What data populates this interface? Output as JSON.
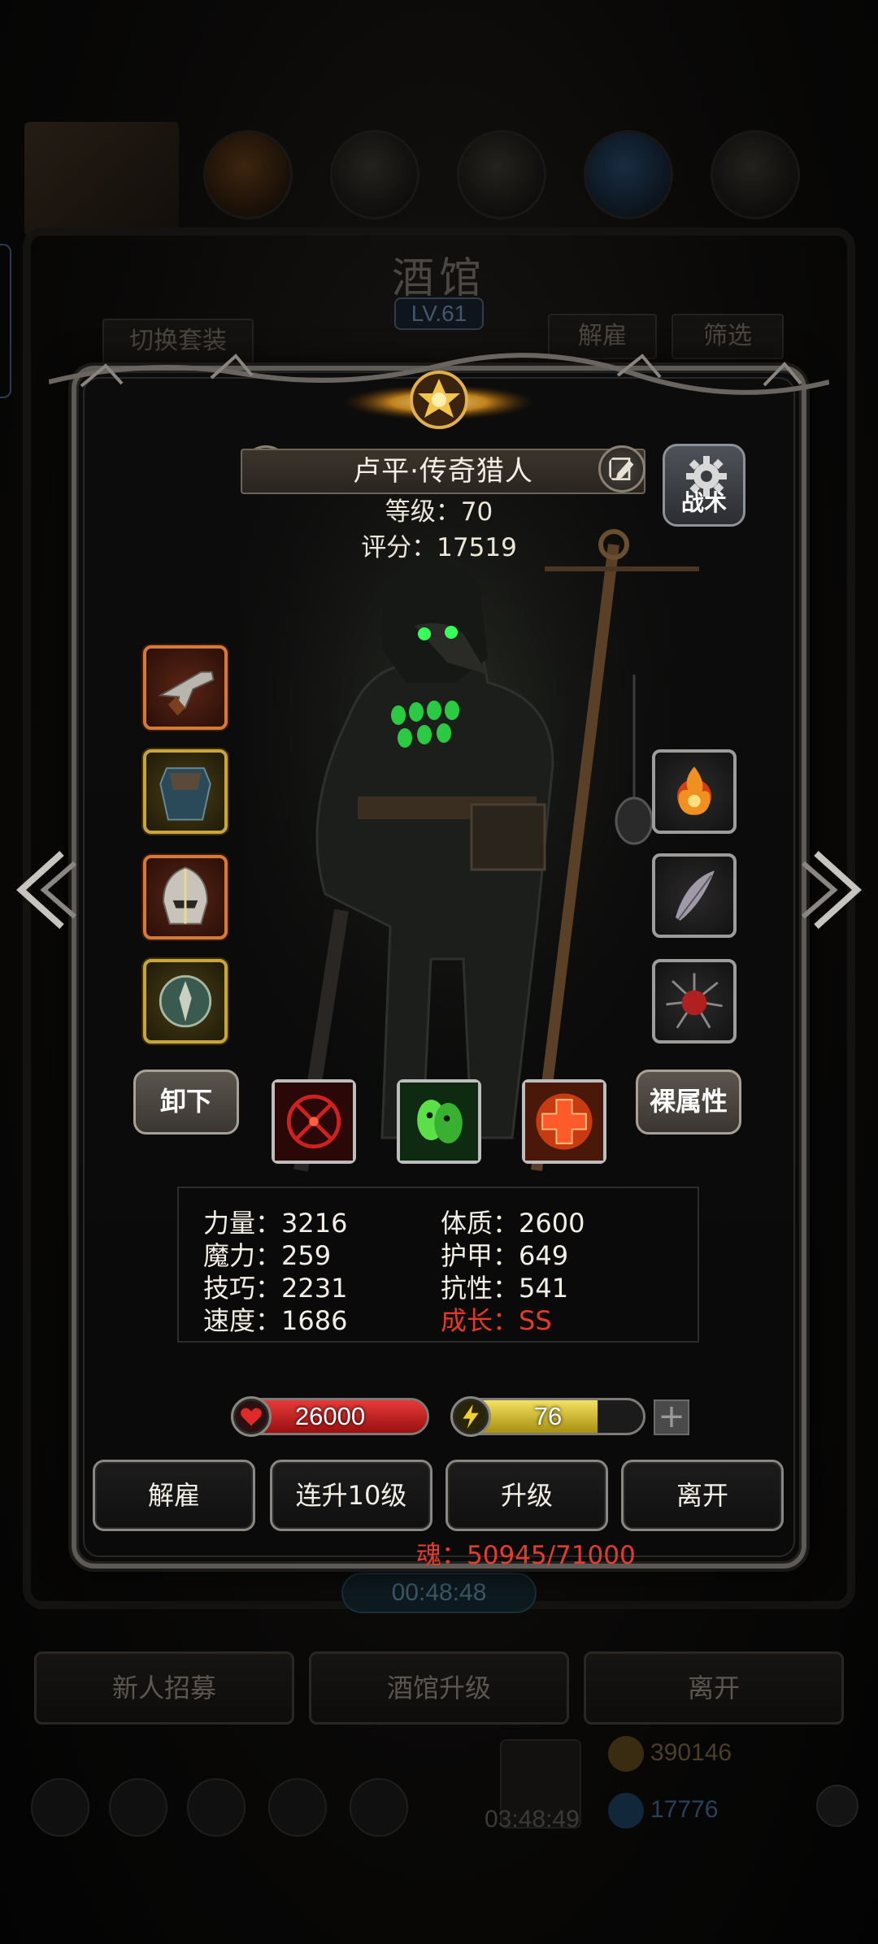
{
  "background": {
    "title": "酒馆",
    "level": "LV.61",
    "switch_outfit": "切换套装",
    "dismiss": "解雇",
    "filter": "筛选",
    "timer": "00:48:48",
    "recruit": "新人招募",
    "upgrade_tavern": "酒馆升级",
    "leave": "离开",
    "gold": "390146",
    "gems": "17776",
    "timer2": "03:48:49"
  },
  "hero": {
    "name": "卢平·传奇猎人",
    "level_text": "等级：70",
    "score_text": "评分：17519",
    "tactic_label": "战术",
    "unequip_label": "卸下",
    "bare_stats_label": "裸属性",
    "equipment_left": [
      "pistol-icon",
      "cloak-armor-icon",
      "helmet-icon",
      "shield-icon"
    ],
    "equipment_right": [
      "fire-orb-icon",
      "feather-icon",
      "spiked-gem-icon"
    ],
    "skills": [
      "crosshair-skill-icon",
      "green-ghost-skill-icon",
      "red-cross-skill-icon"
    ]
  },
  "stats": {
    "strength": "力量：3216",
    "magic": "魔力：259",
    "skill": "技巧：2231",
    "speed": "速度：1686",
    "constitution": "体质：2600",
    "armor": "护甲：649",
    "resistance": "抗性：541",
    "growth": "成长：SS"
  },
  "vitals": {
    "hp": "26000",
    "hp_fill": 1.0,
    "energy": "76",
    "energy_fill": 0.76
  },
  "actions": {
    "dismiss": "解雇",
    "level_up_10": "连升10级",
    "level_up": "升级",
    "leave": "离开"
  },
  "soul_text": "魂：50945/71000",
  "colors": {
    "hp_red": "#c81e1e",
    "energy_yellow": "#d8c020",
    "growth_red": "#e5382b"
  }
}
